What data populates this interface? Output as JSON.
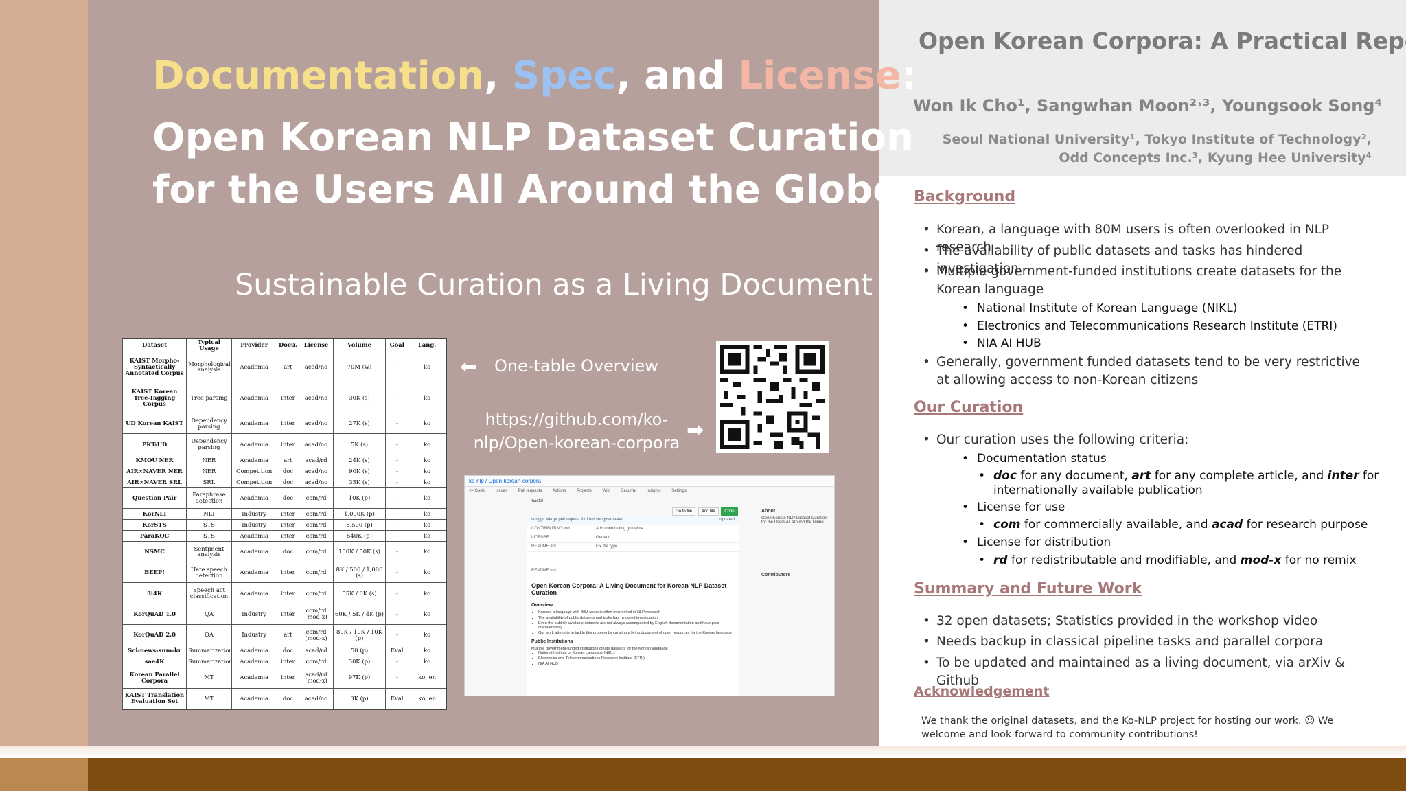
{
  "title": {
    "line1_doc": "Documentation",
    "line1_sep1": ", ",
    "line1_spec": "Spec",
    "line1_and": ", and ",
    "line1_license": "License",
    "line1_colon": ":",
    "line2": "Open Korean NLP Dataset Curation",
    "line3": "for the Users All Around the Globe",
    "subtitle": "Sustainable Curation as a Living Document"
  },
  "table": {
    "headers": [
      "Dataset",
      "Typical Usage",
      "Provider",
      "Docu.",
      "License",
      "Volume",
      "Goal",
      "Lang."
    ],
    "rows": [
      [
        "KAIST Morpho-Syntactically Annotated Corpus",
        "Morphological analysis",
        "Academia",
        "art",
        "acad/no",
        "70M (w)",
        "-",
        "ko"
      ],
      [
        "KAIST Korean Tree-Tagging Corpus",
        "Tree parsing",
        "Academia",
        "inter",
        "acad/no",
        "30K (s)",
        "-",
        "ko"
      ],
      [
        "UD Korean KAIST",
        "Dependency parsing",
        "Academia",
        "inter",
        "acad/no",
        "27K (s)",
        "-",
        "ko"
      ],
      [
        "PKT-UD",
        "Dependency parsing",
        "Academia",
        "inter",
        "acad/no",
        "5K (s)",
        "-",
        "ko"
      ],
      [
        "KMOU NER",
        "NER",
        "Academia",
        "art",
        "acad/rd",
        "24K (s)",
        "-",
        "ko"
      ],
      [
        "AIR×NAVER NER",
        "NER",
        "Competition",
        "doc",
        "acad/no",
        "90K (s)",
        "-",
        "ko"
      ],
      [
        "AIR×NAVER SRL",
        "SRL",
        "Competition",
        "doc",
        "acad/no",
        "35K (s)",
        "-",
        "ko"
      ],
      [
        "Question Pair",
        "Paraphrase detection",
        "Academia",
        "doc",
        "com/rd",
        "10K (p)",
        "-",
        "ko"
      ],
      [
        "KorNLI",
        "NLI",
        "Industry",
        "inter",
        "com/rd",
        "1,000K (p)",
        "-",
        "ko"
      ],
      [
        "KorSTS",
        "STS",
        "Industry",
        "inter",
        "com/rd",
        "8,500 (p)",
        "-",
        "ko"
      ],
      [
        "ParaKQC",
        "STS",
        "Academia",
        "inter",
        "com/rd",
        "540K (p)",
        "-",
        "ko"
      ],
      [
        "NSMC",
        "Sentiment analysis",
        "Academia",
        "doc",
        "com/rd",
        "150K / 50K (s)",
        "-",
        "ko"
      ],
      [
        "BEEP!",
        "Hate speech detection",
        "Academia",
        "inter",
        "com/rd",
        "8K / 500 / 1,000 (s)",
        "-",
        "ko"
      ],
      [
        "3i4K",
        "Speech act classification",
        "Academia",
        "inter",
        "com/rd",
        "55K / 6K (s)",
        "-",
        "ko"
      ],
      [
        "KorQuAD 1.0",
        "QA",
        "Industry",
        "inter",
        "com/rd (mod-x)",
        "60K / 5K / 4K (p)",
        "-",
        "ko"
      ],
      [
        "KorQuAD 2.0",
        "QA",
        "Industry",
        "art",
        "com/rd (mod-x)",
        "80K / 10K / 10K (p)",
        "-",
        "ko"
      ],
      [
        "Sci-news-sum-kr",
        "Summarization",
        "Academia",
        "doc",
        "acad/rd",
        "50 (p)",
        "Eval",
        "ko"
      ],
      [
        "sae4K",
        "Summarization",
        "Academia",
        "inter",
        "com/rd",
        "50K (p)",
        "-",
        "ko"
      ],
      [
        "Korean Parallel Corpora",
        "MT",
        "Academia",
        "inter",
        "acad/rd (mod-x)",
        "97K (p)",
        "-",
        "ko, en"
      ],
      [
        "KAIST Translation Evaluation Set",
        "MT",
        "Academia",
        "doc",
        "acad/no",
        "3K (p)",
        "Eval",
        "ko, en"
      ]
    ]
  },
  "links": {
    "overview_label": "One-table Overview",
    "url": "https://github.com/ko-nlp/Open-korean-corpora"
  },
  "repo_screenshot": {
    "path": "ko-nlp / Open-korean-corpora",
    "tabs": [
      "<> Code",
      "Issues",
      "Pull requests",
      "Actions",
      "Projects",
      "Wiki",
      "Security",
      "Insights",
      "Settings"
    ],
    "branch": "master",
    "buttons": [
      "Go to file",
      "Add file",
      "Code"
    ],
    "files": [
      [
        "songys Merge pull request #1 from songys/master",
        "",
        "updated"
      ],
      [
        "CONTRIBUTING.md",
        "Add contributing guideline",
        ""
      ],
      [
        "LICENSE",
        "Generic",
        ""
      ],
      [
        "README.md",
        "Fix the typo",
        ""
      ]
    ],
    "about_title": "About",
    "about_text": "Open Korean NLP Dataset Curation for the Users All Around the Globe",
    "readme_file": "README.md",
    "readme_title": "Open Korean Corpora: A Living Document for Korean NLP Dataset Curation",
    "overview_heading": "Overview",
    "overview_items": [
      "Korean, a language with 80M users is often overlooked in NLP research",
      "The availability of public datasets and tasks has hindered investigation",
      "Even the publicly available datasets are not always accompanied by English documentation and have poor discoverability",
      "Our work attempts to tackle this problem by curating a living document of open resources for the Korean language"
    ],
    "public_heading": "Public Institutions",
    "public_text": "Multiple government-funded institutions create datasets for the Korean language",
    "public_items": [
      "National Institute of Korean Language (NIKL)",
      "Electronics and Telecommunications Research Institute (ETRI)",
      "NIA AI HUB"
    ],
    "contributors_title": "Contributors"
  },
  "right": {
    "title": "Open Korean Corpora: A Practical Report",
    "authors": "Won Ik Cho¹, Sangwhan Moon²˒³, Youngsook Song⁴",
    "affiliations_1": "Seoul National University¹, Tokyo Institute of Technology²,",
    "affiliations_2": "Odd Concepts Inc.³, Kyung Hee University⁴",
    "background": {
      "heading": "Background",
      "b1": "Korean, a language with 80M users is often overlooked in NLP research",
      "b2": "The availability of public datasets and tasks has hindered investigation",
      "b3": "Multiple government-funded institutions create datasets for the Korean language",
      "sub": [
        "National Institute of Korean Language (NIKL)",
        "Electronics and Telecommunications Research Institute (ETRI)",
        "NIA AI HUB"
      ],
      "b4": "Generally, government funded datasets tend to be very restrictive at allowing access to non-Korean citizens"
    },
    "curation": {
      "heading": "Our Curation",
      "b1": "Our curation uses the following criteria:",
      "s1": "Documentation status",
      "s1a": {
        "t1": "doc",
        "t2": " for any document, ",
        "t3": "art",
        "t4": " for any complete article, and ",
        "t5": "inter",
        "t6": " for internationally available publication"
      },
      "s2": "License for use",
      "s2a": {
        "t1": "com",
        "t2": " for commercially available, and ",
        "t3": "acad",
        "t4": " for research purpose"
      },
      "s3": "License for distribution",
      "s3a": {
        "t1": "rd",
        "t2": " for redistributable and modifiable, and ",
        "t3": "mod-x",
        "t4": " for no remix"
      }
    },
    "summary": {
      "heading": "Summary and Future Work",
      "b1": "32 open datasets; Statistics provided in the workshop video",
      "b2": "Needs backup in classical pipeline tasks and parallel corpora",
      "b3": "To be updated and maintained as a living document, via arXiv & Github"
    },
    "ack": {
      "heading": "Acknowledgement",
      "text": "We thank the original datasets, and the Ko-NLP project for hosting our work. ☺  We welcome and look forward to  community contributions!"
    }
  },
  "colors": {
    "main_panel": "#b6a09c",
    "documentation": "#f6e08c",
    "spec": "#9bc2f2",
    "license": "#f4b7a6",
    "section_heading": "#a87878",
    "bottom_bar": "#7f4c12"
  }
}
